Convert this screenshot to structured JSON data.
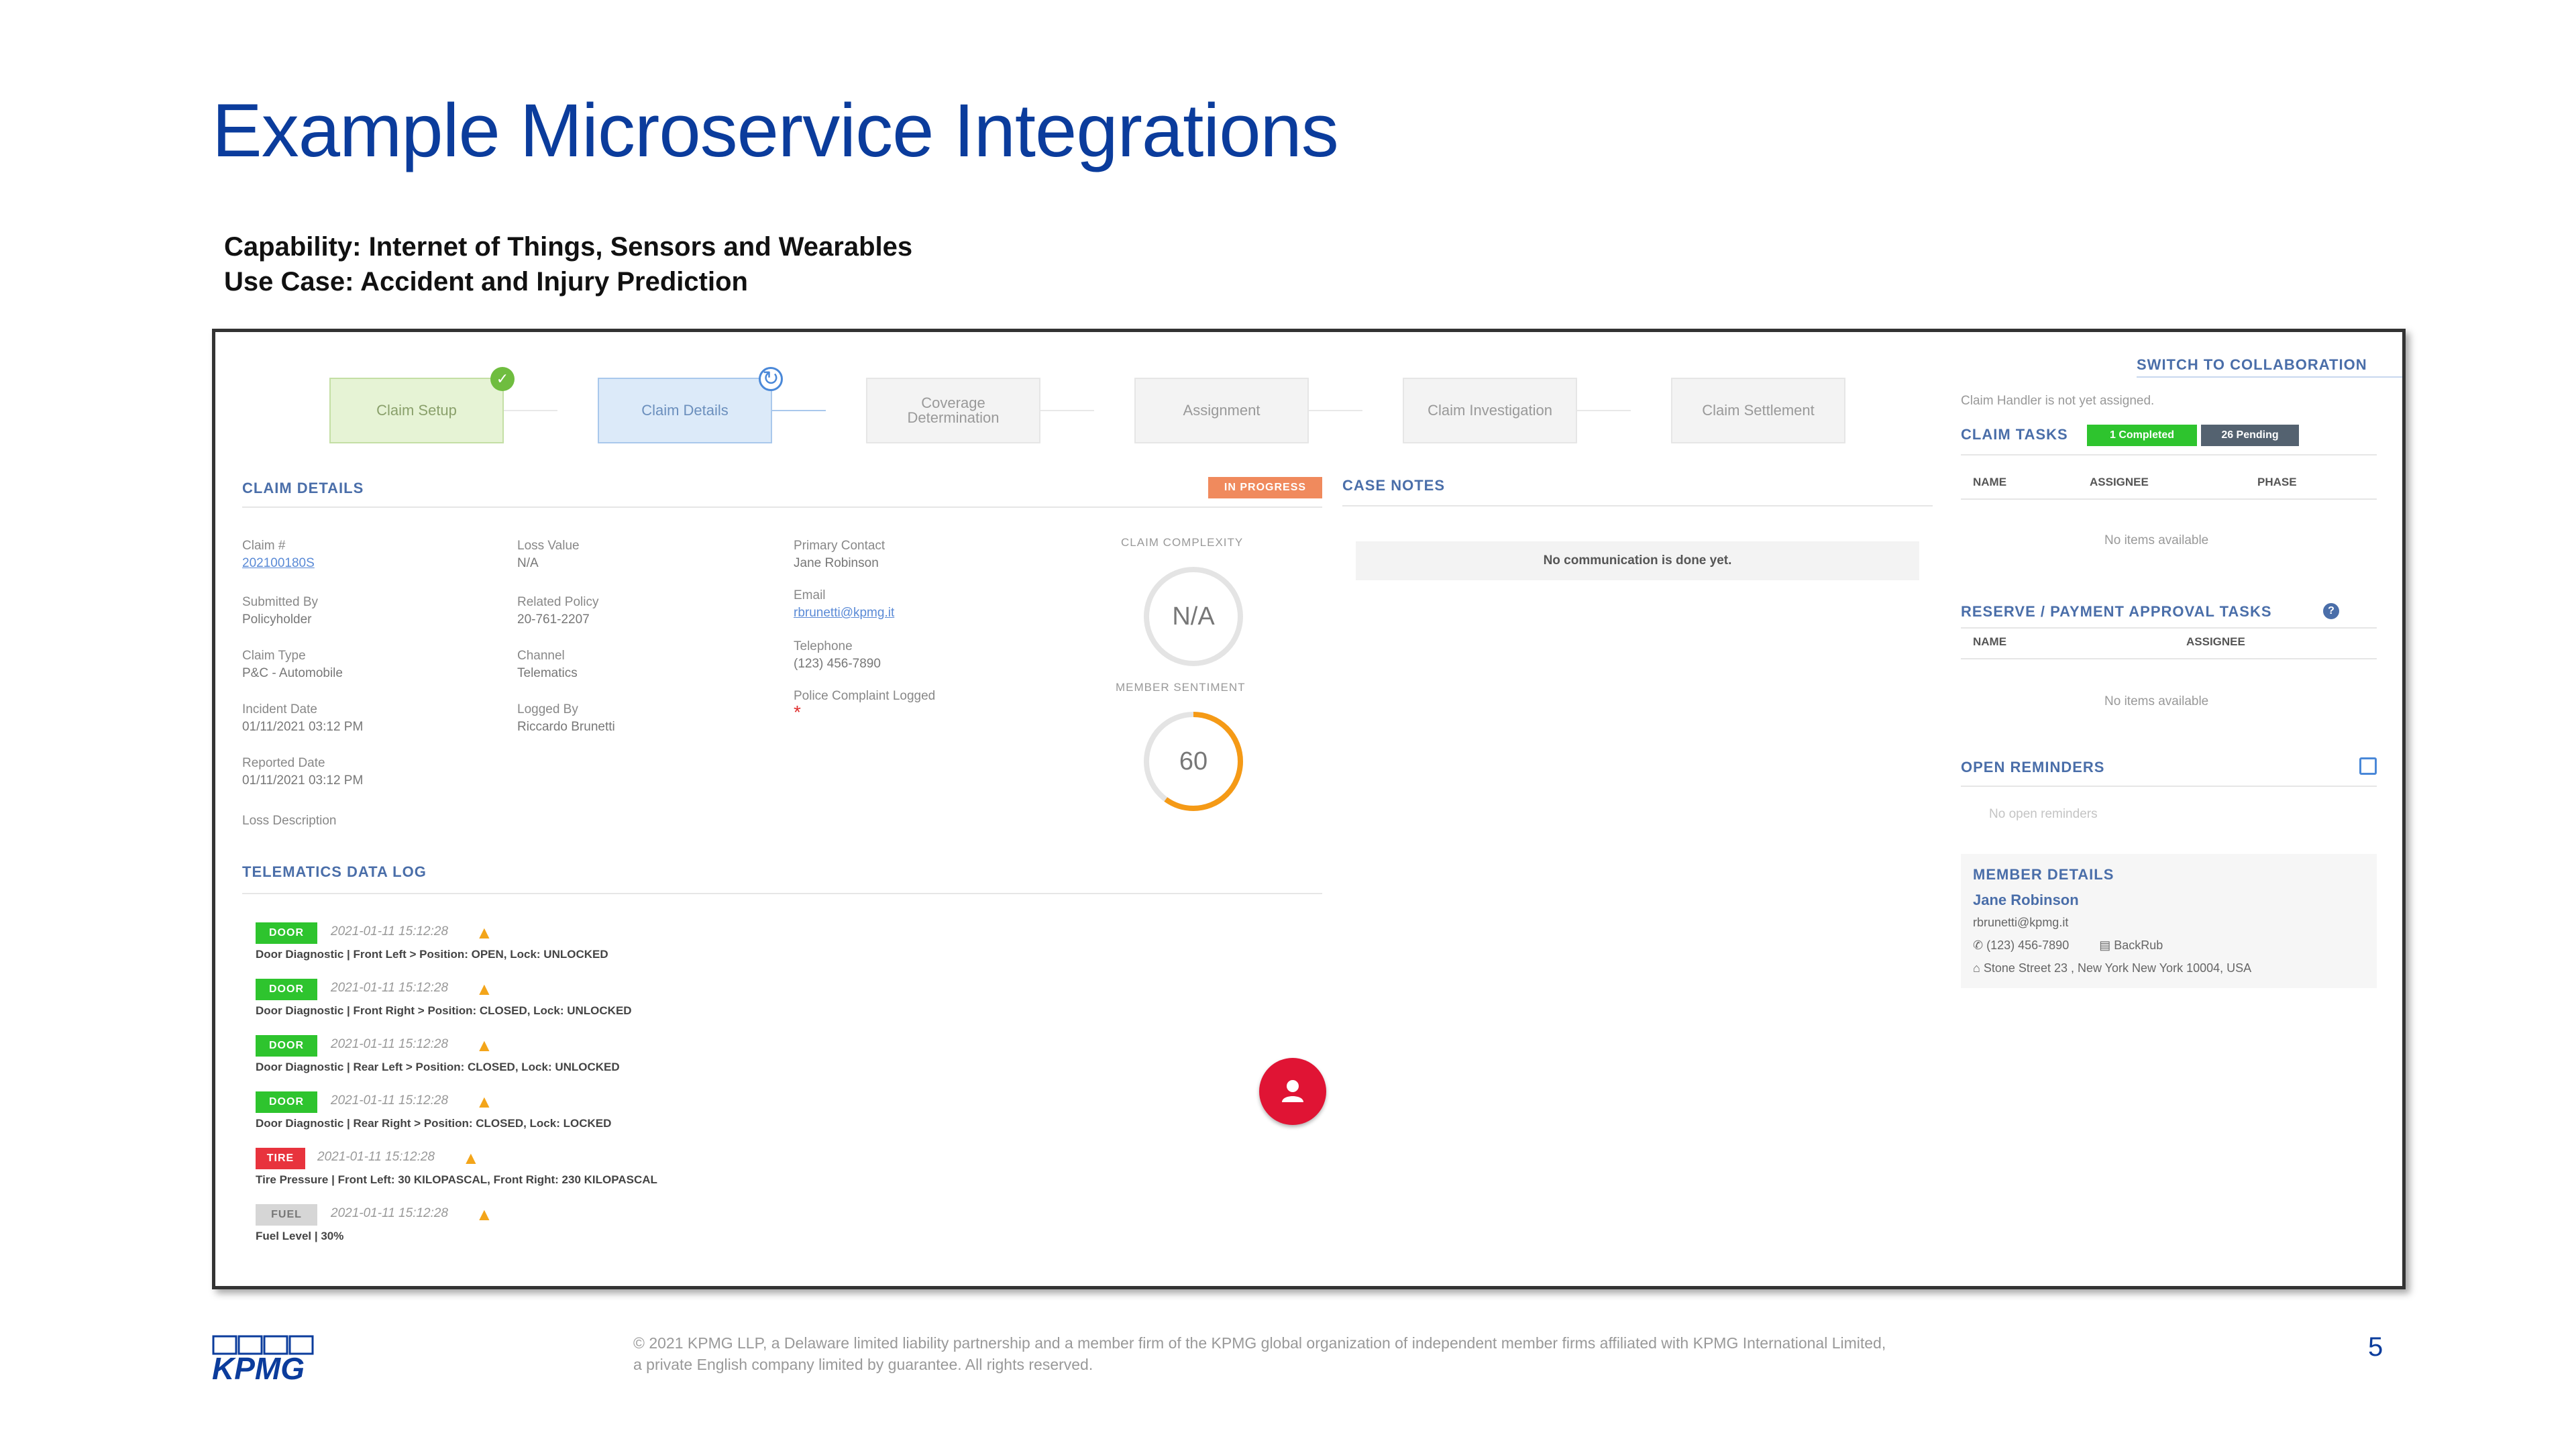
{
  "slide": {
    "title": "Example Microservice Integrations",
    "capability": "Capability: Internet of Things, Sensors and Wearables",
    "use_case": "Use Case: Accident and Injury Prediction",
    "footer_legal_1": "© 2021 KPMG LLP, a Delaware limited liability partnership and a member firm of the KPMG global organization of independent member firms affiliated with KPMG International Limited,",
    "footer_legal_2": "a private English company limited by guarantee. All rights reserved.",
    "page_number": "5",
    "logo_text": "KPMG",
    "brand_color": "#0b3c9c"
  },
  "stepper": {
    "steps": [
      {
        "label": "Claim Setup",
        "state": "done"
      },
      {
        "label": "Claim Details",
        "state": "active"
      },
      {
        "label": "Coverage Determination",
        "state": "pending"
      },
      {
        "label": "Assignment",
        "state": "pending"
      },
      {
        "label": "Claim Investigation",
        "state": "pending"
      },
      {
        "label": "Claim Settlement",
        "state": "pending"
      }
    ]
  },
  "claim_details": {
    "heading": "CLAIM DETAILS",
    "status_badge": "IN PROGRESS",
    "fields": {
      "claim_no_label": "Claim #",
      "claim_no": "202100180S",
      "submitted_by_label": "Submitted By",
      "submitted_by": "Policyholder",
      "claim_type_label": "Claim Type",
      "claim_type": "P&C - Automobile",
      "incident_date_label": "Incident Date",
      "incident_date": "01/11/2021 03:12 PM",
      "reported_date_label": "Reported Date",
      "reported_date": "01/11/2021 03:12 PM",
      "loss_description_label": "Loss Description",
      "loss_value_label": "Loss Value",
      "loss_value": "N/A",
      "related_policy_label": "Related Policy",
      "related_policy": "20-761-2207",
      "channel_label": "Channel",
      "channel": "Telematics",
      "logged_by_label": "Logged By",
      "logged_by": "Riccardo Brunetti",
      "primary_contact_label": "Primary Contact",
      "primary_contact": "Jane Robinson",
      "email_label": "Email",
      "email": "rbrunetti@kpmg.it",
      "telephone_label": "Telephone",
      "telephone": "(123) 456-7890",
      "police_label": "Police Complaint Logged",
      "police_value": "*"
    },
    "complexity_label": "CLAIM COMPLEXITY",
    "complexity_value": "N/A",
    "sentiment_label": "MEMBER SENTIMENT",
    "sentiment_value": "60",
    "sentiment_fraction": 0.6
  },
  "telematics": {
    "heading": "TELEMATICS DATA LOG",
    "entries": [
      {
        "tag": "DOOR",
        "kind": "door",
        "time": "2021-01-11 15:12:28",
        "desc": "Door Diagnostic | Front Left > Position: OPEN, Lock: UNLOCKED"
      },
      {
        "tag": "DOOR",
        "kind": "door",
        "time": "2021-01-11 15:12:28",
        "desc": "Door Diagnostic | Front Right > Position: CLOSED, Lock: UNLOCKED"
      },
      {
        "tag": "DOOR",
        "kind": "door",
        "time": "2021-01-11 15:12:28",
        "desc": "Door Diagnostic | Rear Left > Position: CLOSED, Lock: UNLOCKED"
      },
      {
        "tag": "DOOR",
        "kind": "door",
        "time": "2021-01-11 15:12:28",
        "desc": "Door Diagnostic | Rear Right > Position: CLOSED, Lock: LOCKED"
      },
      {
        "tag": "TIRE",
        "kind": "tire",
        "time": "2021-01-11 15:12:28",
        "desc": "Tire Pressure | Front Left: 30 KILOPASCAL, Front Right: 230 KILOPASCAL"
      },
      {
        "tag": "FUEL",
        "kind": "fuel",
        "time": "2021-01-11 15:12:28",
        "desc": "Fuel Level | 30%"
      }
    ]
  },
  "case_notes": {
    "heading": "CASE NOTES",
    "empty_text": "No communication is done yet."
  },
  "right_panel": {
    "switch_link": "SWITCH TO COLLABORATION",
    "handler_text": "Claim Handler is not yet assigned.",
    "claim_tasks_heading": "CLAIM TASKS",
    "completed_pill": "1 Completed",
    "pending_pill": "26 Pending",
    "tasks_col_name": "NAME",
    "tasks_col_assignee": "ASSIGNEE",
    "tasks_col_phase": "PHASE",
    "tasks_empty": "No items available",
    "reserve_heading": "RESERVE / PAYMENT APPROVAL TASKS",
    "reserve_col_name": "NAME",
    "reserve_col_assignee": "ASSIGNEE",
    "reserve_empty": "No items available",
    "reminders_heading": "OPEN REMINDERS",
    "reminders_empty": "No open reminders",
    "member_heading": "MEMBER DETAILS",
    "member_name": "Jane Robinson",
    "member_email": "rbrunetti@kpmg.it",
    "member_phone": "(123) 456-7890",
    "member_account": "BackRub",
    "member_address": "Stone Street 23 , New York New York 10004, USA"
  }
}
